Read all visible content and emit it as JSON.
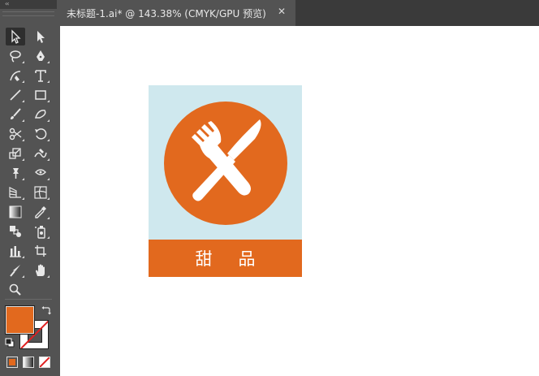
{
  "app": {
    "tools_header": "‹‹"
  },
  "document": {
    "tab_title": "未标题-1.ai* @ 143.38% (CMYK/GPU 预览)",
    "close_glyph": "✕"
  },
  "artwork": {
    "label": "甜品",
    "colors": {
      "background": "#cfe8ee",
      "accent": "#e2691e",
      "icon": "#ffffff"
    }
  },
  "swatches": {
    "fill_color": "#e2691e",
    "stroke": "none"
  },
  "tools": [
    {
      "name": "selection-tool",
      "active": true
    },
    {
      "name": "direct-selection-tool"
    },
    {
      "name": "magic-wand-tool"
    },
    {
      "name": "pen-tool"
    },
    {
      "name": "curvature-tool"
    },
    {
      "name": "type-tool",
      "glyph": "T"
    },
    {
      "name": "line-segment-tool"
    },
    {
      "name": "rectangle-tool"
    },
    {
      "name": "paintbrush-tool"
    },
    {
      "name": "shaper-tool"
    },
    {
      "name": "scissors-tool"
    },
    {
      "name": "rotate-tool"
    },
    {
      "name": "scale-tool"
    },
    {
      "name": "warp-tool"
    },
    {
      "name": "puppet-warp-tool"
    },
    {
      "name": "free-transform-tool"
    },
    {
      "name": "perspective-grid-tool"
    },
    {
      "name": "mesh-tool"
    },
    {
      "name": "gradient-tool"
    },
    {
      "name": "eyedropper-tool"
    },
    {
      "name": "blend-tool"
    },
    {
      "name": "symbol-sprayer-tool"
    },
    {
      "name": "column-graph-tool"
    },
    {
      "name": "artboard-tool"
    },
    {
      "name": "slice-tool"
    },
    {
      "name": "hand-tool"
    },
    {
      "name": "zoom-tool"
    }
  ]
}
